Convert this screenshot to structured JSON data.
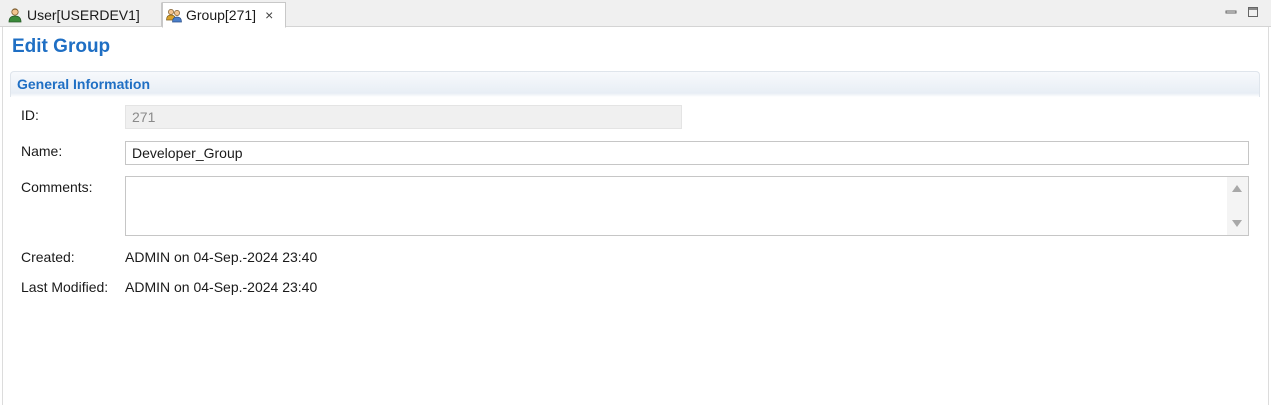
{
  "tabs": [
    {
      "label": "User[USERDEV1]",
      "icon": "user-icon",
      "active": false
    },
    {
      "label": "Group[271]",
      "icon": "group-icon",
      "active": true,
      "close": "×"
    }
  ],
  "page": {
    "title": "Edit Group"
  },
  "section": {
    "title": "General Information"
  },
  "form": {
    "id_label": "ID:",
    "id_value": "271",
    "name_label": "Name:",
    "name_value": "Developer_Group",
    "comments_label": "Comments:",
    "comments_value": "",
    "created_label": "Created:",
    "created_value": "ADMIN on 04-Sep.-2024 23:40",
    "modified_label": "Last Modified:",
    "modified_value": "ADMIN on 04-Sep.-2024 23:40"
  },
  "colors": {
    "title": "#1f6fc4",
    "section": "#1f6fc4"
  }
}
